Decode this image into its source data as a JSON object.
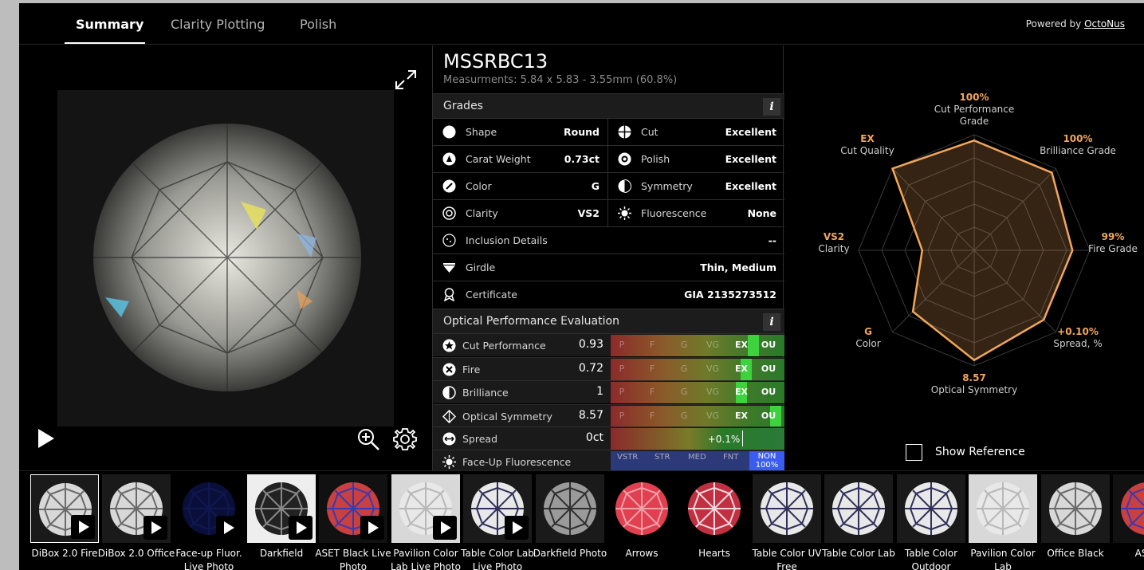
{
  "tabs": [
    {
      "label": "Summary",
      "active": true
    },
    {
      "label": "Clarity Plotting",
      "active": false
    },
    {
      "label": "Polish",
      "active": false
    }
  ],
  "powered": {
    "prefix": "Powered by ",
    "link": "OctoNus"
  },
  "stone": {
    "id": "MSSRBC13",
    "measurements": "Measurments: 5.84 x 5.83 - 3.55mm (60.8%)"
  },
  "grades_title": "Grades",
  "info_glyph": "i",
  "grades": [
    {
      "left": {
        "icon": "shape-icon",
        "label": "Shape",
        "value": "Round"
      },
      "right": {
        "icon": "cut-icon",
        "label": "Cut",
        "value": "Excellent"
      }
    },
    {
      "left": {
        "icon": "carat-icon",
        "label": "Carat Weight",
        "value": "0.73ct"
      },
      "right": {
        "icon": "polish-icon",
        "label": "Polish",
        "value": "Excellent"
      }
    },
    {
      "left": {
        "icon": "color-icon",
        "label": "Color",
        "value": "G"
      },
      "right": {
        "icon": "symmetry-icon",
        "label": "Symmetry",
        "value": "Excellent"
      }
    },
    {
      "left": {
        "icon": "clarity-icon",
        "label": "Clarity",
        "value": "VS2"
      },
      "right": {
        "icon": "fluorescence-icon",
        "label": "Fluorescence",
        "value": "None"
      }
    }
  ],
  "full_rows": [
    {
      "icon": "inclusion-icon",
      "label": "Inclusion Details",
      "value": "--"
    },
    {
      "icon": "girdle-icon",
      "label": "Girdle",
      "value": "Thin, Medium"
    },
    {
      "icon": "certificate-icon",
      "label": "Certificate",
      "value": "GIA 2135273512"
    }
  ],
  "optical_title": "Optical Performance Evaluation",
  "scale_labels": [
    "P",
    "F",
    "G",
    "VG",
    "EX",
    "OU"
  ],
  "performance": [
    {
      "icon": "star-icon",
      "label": "Cut Performance",
      "value": "0.93",
      "level": 0.82
    },
    {
      "icon": "fire-icon",
      "label": "Fire",
      "value": "0.72",
      "level": 0.78
    },
    {
      "icon": "brilliance-icon",
      "label": "Brilliance",
      "value": "1",
      "level": 0.75
    },
    {
      "icon": "optical-symmetry-icon",
      "label": "Optical Symmetry",
      "value": "8.57",
      "level": 0.95
    }
  ],
  "spread": {
    "icon": "spread-icon",
    "label": "Spread",
    "value": "0ct",
    "reading": "+0.1%"
  },
  "faceup": {
    "icon": "sun-icon",
    "label": "Face-Up Fluorescence",
    "scale": [
      "VSTR",
      "STR",
      "MED",
      "FNT"
    ],
    "selected": "NON",
    "selected_sub": "100%"
  },
  "radar": {
    "axes": [
      {
        "value": "100%",
        "label": "Cut Performance Grade",
        "level": 0.95
      },
      {
        "value": "100%",
        "label": "Brilliance Grade",
        "level": 0.95
      },
      {
        "value": "99%",
        "label": "Fire Grade",
        "level": 0.85
      },
      {
        "value": "+0.10%",
        "label": "Spread, %",
        "level": 0.85
      },
      {
        "value": "8.57",
        "label": "Optical Symmetry",
        "level": 0.95
      },
      {
        "value": "G",
        "label": "Color",
        "level": 0.75
      },
      {
        "value": "VS2",
        "label": "Clarity",
        "level": 0.45
      },
      {
        "value": "EX",
        "label": "Cut Quality",
        "level": 1.0
      }
    ],
    "accent": "#f2a65c"
  },
  "show_reference": "Show Reference",
  "thumbnails": [
    {
      "caption": "DiBox 2.0 Fire",
      "style": "white",
      "play": true,
      "selected": true
    },
    {
      "caption": "DiBox 2.0 Office",
      "style": "white",
      "play": true,
      "selected": false
    },
    {
      "caption": "Face-up Fluor. Live Photo",
      "style": "blue",
      "play": true,
      "selected": false
    },
    {
      "caption": "Darkfield",
      "style": "darkfield",
      "play": true,
      "selected": false
    },
    {
      "caption": "ASET Black Live Photo",
      "style": "aset",
      "play": true,
      "selected": false
    },
    {
      "caption": "Pavilion Color Lab Live Photo",
      "style": "pavilion",
      "play": true,
      "selected": false
    },
    {
      "caption": "Table Color Lab Live Photo",
      "style": "arrowswhite",
      "play": true,
      "selected": false
    },
    {
      "caption": "Darkfield Photo",
      "style": "darkgray",
      "play": false,
      "selected": false
    },
    {
      "caption": "Arrows",
      "style": "red",
      "play": false,
      "selected": false
    },
    {
      "caption": "Hearts",
      "style": "hearts",
      "play": false,
      "selected": false
    },
    {
      "caption": "Table Color UV Free",
      "style": "arrowswhite",
      "play": false,
      "selected": false
    },
    {
      "caption": "Table Color Lab",
      "style": "arrowswhite",
      "play": false,
      "selected": false
    },
    {
      "caption": "Table Color Outdoor",
      "style": "arrowswhite",
      "play": false,
      "selected": false
    },
    {
      "caption": "Pavilion Color Lab",
      "style": "pavilion",
      "play": false,
      "selected": false
    },
    {
      "caption": "Office Black",
      "style": "white",
      "play": false,
      "selected": false
    },
    {
      "caption": "ASET",
      "style": "aset",
      "play": false,
      "selected": false
    }
  ]
}
